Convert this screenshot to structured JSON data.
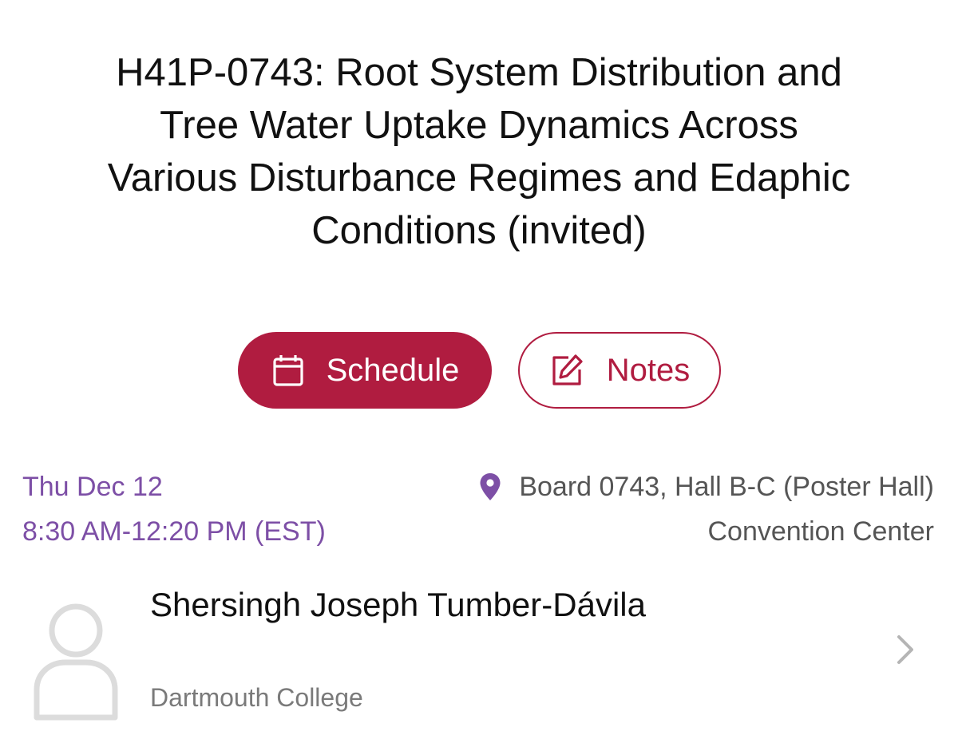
{
  "session": {
    "title": "H41P-0743: Root System Distribution and Tree Water Uptake Dynamics Across Various Disturbance Regimes and Edaphic Conditions (invited)",
    "title_lines": [
      "H41P-0743: Root System Distribution and",
      "Tree Water Uptake Dynamics Across",
      "Various Disturbance Regimes and Edaphic",
      "Conditions (invited)"
    ]
  },
  "actions": {
    "schedule_label": "Schedule",
    "notes_label": "Notes",
    "schedule_icon": "calendar-icon",
    "notes_icon": "edit-note-icon"
  },
  "when": {
    "date": "Thu Dec 12",
    "time": "8:30 AM-12:20 PM (EST)"
  },
  "where": {
    "icon": "location-pin-icon",
    "board": "Board 0743, Hall B-C (Poster Hall)",
    "venue": "Convention Center"
  },
  "presenter": {
    "name": "Shersingh Joseph Tumber-Dávila",
    "affiliation": "Dartmouth College",
    "avatar_icon": "person-placeholder-icon",
    "chevron_icon": "chevron-right-icon"
  },
  "colors": {
    "accent": "#b01c40",
    "datetime": "#7d4fa6",
    "secondary_text": "#555555"
  }
}
